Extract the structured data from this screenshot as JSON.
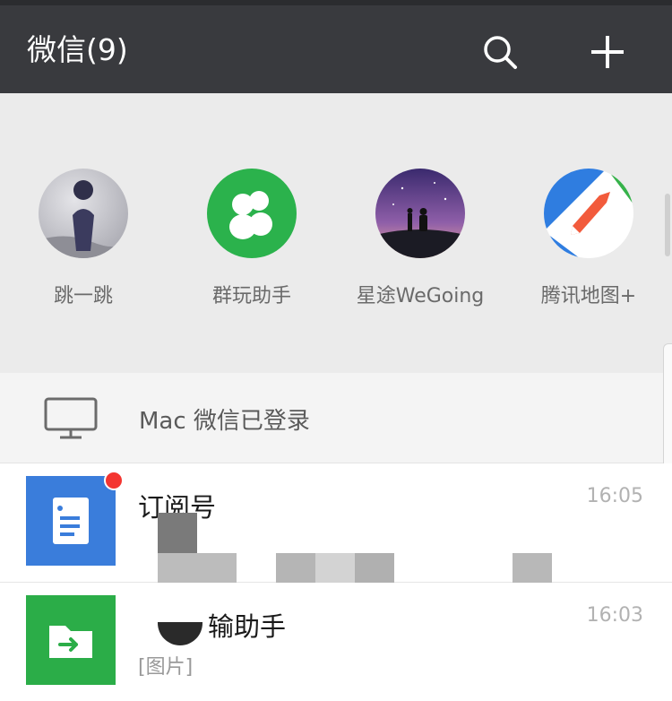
{
  "header": {
    "title": "微信(9)",
    "search_icon": "search-icon",
    "add_icon": "plus-icon"
  },
  "mini_programs": [
    {
      "label": "跳一跳",
      "icon": "jump-jump-app-icon"
    },
    {
      "label": "群玩助手",
      "icon": "group-play-app-icon"
    },
    {
      "label": "星途WeGoing",
      "icon": "wegoing-app-icon"
    },
    {
      "label": "腾讯地图+",
      "icon": "tencent-map-app-icon"
    }
  ],
  "login_notice": {
    "icon": "monitor-icon",
    "text": "Mac 微信已登录"
  },
  "chats": [
    {
      "name": "订阅号",
      "time": "16:05",
      "preview": "",
      "avatar_color": "#3a7ddb",
      "unread": true
    },
    {
      "name": "输助手",
      "time": "16:03",
      "preview": "[图片]",
      "avatar_color": "#2bad48",
      "unread": false
    }
  ],
  "colors": {
    "header_bg": "#393a3e",
    "wechat_green": "#2bad48",
    "unread_red": "#f43530"
  }
}
